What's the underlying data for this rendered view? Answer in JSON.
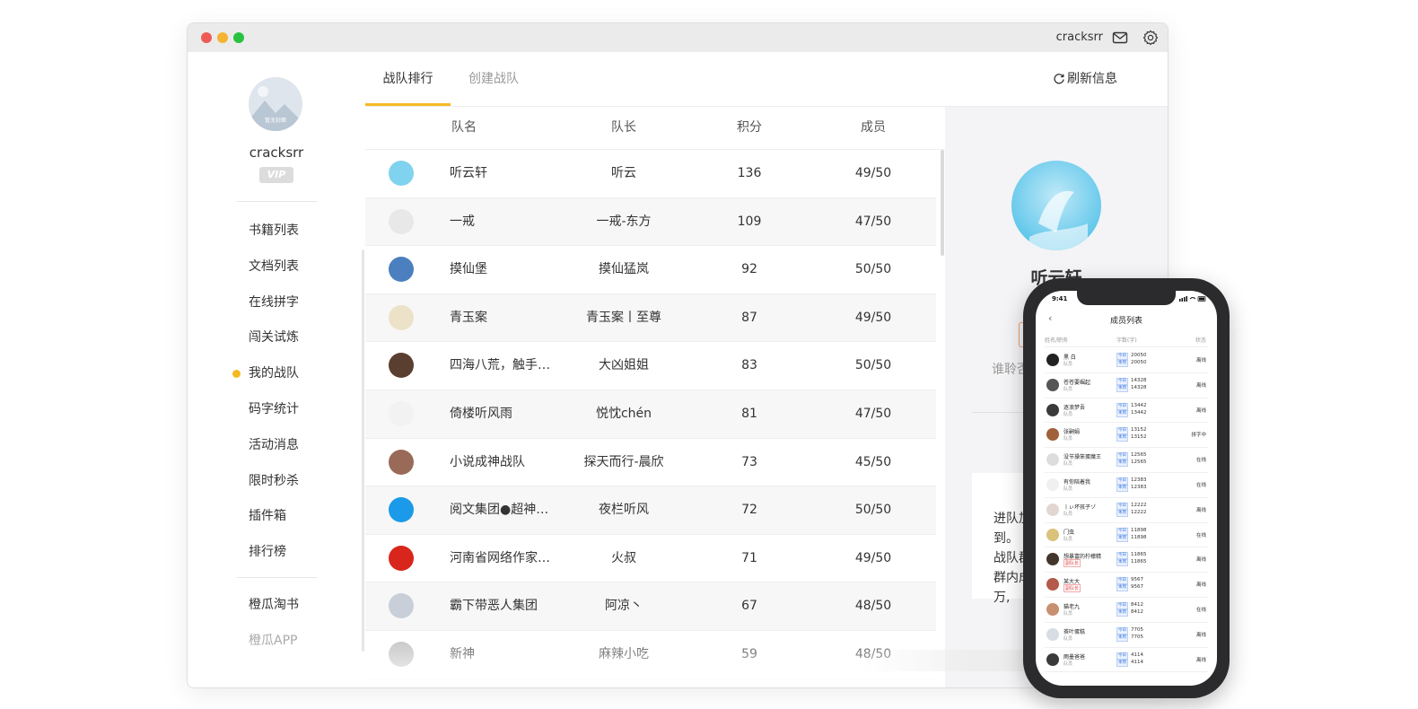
{
  "titlebar": {
    "username": "cracksrr",
    "mail_icon": "mail-icon",
    "settings_icon": "gear-icon"
  },
  "sidebar": {
    "username": "cracksrr",
    "vip_badge": "VIP",
    "avatar_caption": "暂无封面",
    "menu": [
      {
        "label": "书籍列表",
        "active": false
      },
      {
        "label": "文档列表",
        "active": false
      },
      {
        "label": "在线拼字",
        "active": false
      },
      {
        "label": "闯关试炼",
        "active": false
      },
      {
        "label": "我的战队",
        "active": true
      },
      {
        "label": "码字统计",
        "active": false
      },
      {
        "label": "活动消息",
        "active": false
      },
      {
        "label": "限时秒杀",
        "active": false
      },
      {
        "label": "插件箱",
        "active": false
      },
      {
        "label": "排行榜",
        "active": false
      }
    ],
    "extras": [
      {
        "label": "橙瓜淘书"
      },
      {
        "label": "橙瓜APP"
      }
    ]
  },
  "tabs": [
    {
      "label": "战队排行",
      "active": true
    },
    {
      "label": "创建战队",
      "active": false
    }
  ],
  "refresh_label": "刷新信息",
  "table": {
    "columns": [
      "队名",
      "队长",
      "积分",
      "成员"
    ],
    "rows": [
      {
        "name": "听云轩",
        "leader": "听云",
        "score": "136",
        "members": "49/50",
        "avatar_color": "#7fd3ee"
      },
      {
        "name": "一戒",
        "leader": "一戒-东方",
        "score": "109",
        "members": "47/50",
        "avatar_color": "#e8e8e8"
      },
      {
        "name": "摸仙堡",
        "leader": "摸仙猛岚",
        "score": "92",
        "members": "50/50",
        "avatar_color": "#4c7fbf"
      },
      {
        "name": "青玉案",
        "leader": "青玉案丨至尊",
        "score": "87",
        "members": "49/50",
        "avatar_color": "#ece2c8"
      },
      {
        "name": "四海八荒，触手…",
        "leader": "大凶姐姐",
        "score": "83",
        "members": "50/50",
        "avatar_color": "#5a3e30"
      },
      {
        "name": "倚楼听风雨",
        "leader": "悦忱chén",
        "score": "81",
        "members": "47/50",
        "avatar_color": "#f2f2f2"
      },
      {
        "name": "小说成神战队",
        "leader": "探天而行-晨欣",
        "score": "73",
        "members": "45/50",
        "avatar_color": "#9a6a58"
      },
      {
        "name": "阅文集团●超神…",
        "leader": "夜栏听风",
        "score": "72",
        "members": "50/50",
        "avatar_color": "#1a9ae8"
      },
      {
        "name": "河南省网络作家…",
        "leader": "火叔",
        "score": "71",
        "members": "49/50",
        "avatar_color": "#d8261c"
      },
      {
        "name": "霸下带恶人集团",
        "leader": "阿凉丶",
        "score": "67",
        "members": "48/50",
        "avatar_color": "#c8cfd8"
      },
      {
        "name": "新神",
        "leader": "麻辣小吃",
        "score": "59",
        "members": "48/50",
        "avatar_color": "#bbbbbb"
      }
    ]
  },
  "detail": {
    "team_name": "听云轩",
    "desc": "谁聆否明。",
    "card_text": [
      "进队加",
      "到。",
      "战队群",
      "群内成",
      "万,"
    ]
  },
  "phone": {
    "time": "9:41",
    "title": "成员列表",
    "header": {
      "name": "姓名/职务",
      "words": "字数(字)",
      "status": "状态"
    },
    "badge_today": "今日",
    "badge_month": "本周",
    "members": [
      {
        "name": "黑 白",
        "role": "队员",
        "role_red": false,
        "today": "20050",
        "month": "20050",
        "status": "离线",
        "color": "#222222"
      },
      {
        "name": "苍苍要崛起",
        "role": "队员",
        "role_red": false,
        "today": "14328",
        "month": "14328",
        "status": "离线",
        "color": "#555555"
      },
      {
        "name": "逐浪梦吾",
        "role": "队员",
        "role_red": false,
        "today": "13442",
        "month": "13442",
        "status": "离线",
        "color": "#3a3a3a"
      },
      {
        "name": "张嗣娟",
        "role": "队员",
        "role_red": false,
        "today": "13152",
        "month": "13152",
        "status": "拼字中",
        "color": "#a0603a"
      },
      {
        "name": "没节操笨蛋魔王",
        "role": "队员",
        "role_red": false,
        "today": "12565",
        "month": "12565",
        "status": "在线",
        "color": "#dddddd"
      },
      {
        "name": "有你陪着我",
        "role": "队员",
        "role_red": false,
        "today": "12383",
        "month": "12383",
        "status": "在线",
        "color": "#f0f0f0"
      },
      {
        "name": "丨ぃ坏孩子ゾ",
        "role": "队员",
        "role_red": false,
        "today": "12222",
        "month": "12222",
        "status": "离线",
        "color": "#e2d6d2"
      },
      {
        "name": "门虫",
        "role": "队员",
        "role_red": false,
        "today": "11898",
        "month": "11898",
        "status": "在线",
        "color": "#d9c27a"
      },
      {
        "name": "想暴富的柠檬精",
        "role": "副队长",
        "role_red": true,
        "today": "11865",
        "month": "11865",
        "status": "离线",
        "color": "#44352c"
      },
      {
        "name": "某大大",
        "role": "副队长",
        "role_red": true,
        "today": "9567",
        "month": "9567",
        "status": "离线",
        "color": "#b35a4a"
      },
      {
        "name": "猫老九",
        "role": "队员",
        "role_red": false,
        "today": "8412",
        "month": "8412",
        "status": "在线",
        "color": "#c89070"
      },
      {
        "name": "茶叶蛋糕",
        "role": "队员",
        "role_red": false,
        "today": "7705",
        "month": "7705",
        "status": "离线",
        "color": "#d8dde4"
      },
      {
        "name": "雨墨爸爸",
        "role": "队员",
        "role_red": false,
        "today": "4114",
        "month": "4114",
        "status": "离线",
        "color": "#3a3a3a"
      }
    ]
  }
}
